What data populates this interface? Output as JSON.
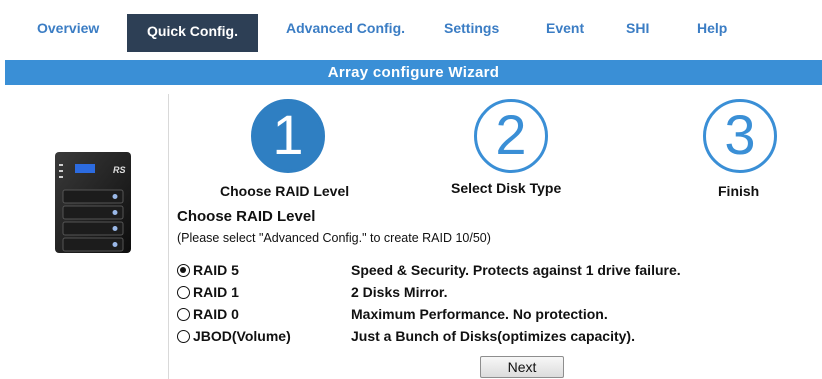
{
  "tabs": [
    {
      "label": "Overview",
      "active": false
    },
    {
      "label": "Quick Config.",
      "active": true
    },
    {
      "label": "Advanced Config.",
      "active": false
    },
    {
      "label": "Settings",
      "active": false
    },
    {
      "label": "Event",
      "active": false
    },
    {
      "label": "SHI",
      "active": false
    },
    {
      "label": "Help",
      "active": false
    }
  ],
  "wizard": {
    "title": "Array configure Wizard",
    "device_logo_text": "RS",
    "steps": [
      {
        "number": "1",
        "label": "Choose RAID Level",
        "active": true
      },
      {
        "number": "2",
        "label": "Select Disk Type",
        "active": false
      },
      {
        "number": "3",
        "label": "Finish",
        "active": false
      }
    ],
    "heading": "Choose RAID Level",
    "note": "(Please select \"Advanced Config.\" to create RAID 10/50)",
    "options": [
      {
        "label": "RAID 5",
        "description": "Speed & Security. Protects against 1 drive failure.",
        "selected": true
      },
      {
        "label": "RAID 1",
        "description": "2 Disks Mirror.",
        "selected": false
      },
      {
        "label": "RAID 0",
        "description": "Maximum Performance. No protection.",
        "selected": false
      },
      {
        "label": "JBOD(Volume)",
        "description": "Just a Bunch of Disks(optimizes capacity).",
        "selected": false
      }
    ],
    "next_label": "Next"
  },
  "colors": {
    "tab_text": "#3b7dc4",
    "active_tab_bg": "#2d3f55",
    "title_bar": "#3a8fd6",
    "step_active": "#2f7fc2"
  }
}
